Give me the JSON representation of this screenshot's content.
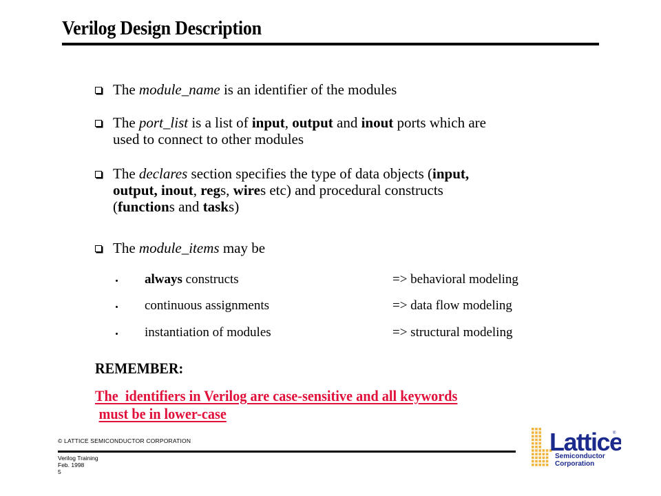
{
  "title": "Verilog Design Description",
  "bullets": [
    {
      "line1": {
        "t1": "The ",
        "i1": "module_name",
        "t2": " is an identifier of the modules"
      }
    },
    {
      "line1": {
        "t1": "The ",
        "i1": "port_list",
        "t2": " is a list of ",
        "b1": "input",
        "t3": ", ",
        "b2": "output",
        "t4": " and ",
        "b3": "inout",
        "t5": " ports which are"
      },
      "line2": "used to connect to other modules"
    },
    {
      "line1": {
        "t1": "The ",
        "i1": "declares",
        "t2": " section specifies the type of data objects (",
        "b1": "input,"
      },
      "line2": {
        "b1": "output, inout",
        "t1": ", ",
        "b2": "reg",
        "t2": "s, ",
        "b3": "wire",
        "t3": "s etc) and procedural constructs"
      },
      "line3": {
        "t1": "(",
        "b1": "function",
        "t2": "s and ",
        "b2": "task",
        "t3": "s)"
      }
    },
    {
      "line1": {
        "t1": "The ",
        "i1": "module_items",
        "t2": " may be"
      }
    }
  ],
  "module_items": [
    {
      "bold": "always",
      "left": " constructs",
      "right": "=> behavioral modeling"
    },
    {
      "bold": "",
      "left": "continuous assignments",
      "right": "=> data flow modeling"
    },
    {
      "bold": "",
      "left": "instantiation of modules",
      "right": "=> structural modeling"
    }
  ],
  "remember_label": "REMEMBER:",
  "warning": {
    "line1": "The  identifiers in Verilog are case-sensitive and all keywords",
    "line2": "must be in lower-case",
    "color": "#e0103a"
  },
  "footer": {
    "copyright": "© LATTICE SEMICONDUCTOR CORPORATION",
    "course": "Verilog Training",
    "date": "Feb.  1998",
    "page": "5"
  },
  "logo": {
    "name": "Lattice",
    "registered": "®",
    "line1": "Semiconductor",
    "line2": "Corporation",
    "text_color": "#1b2a8c",
    "dot_color": "#f0b43c"
  }
}
